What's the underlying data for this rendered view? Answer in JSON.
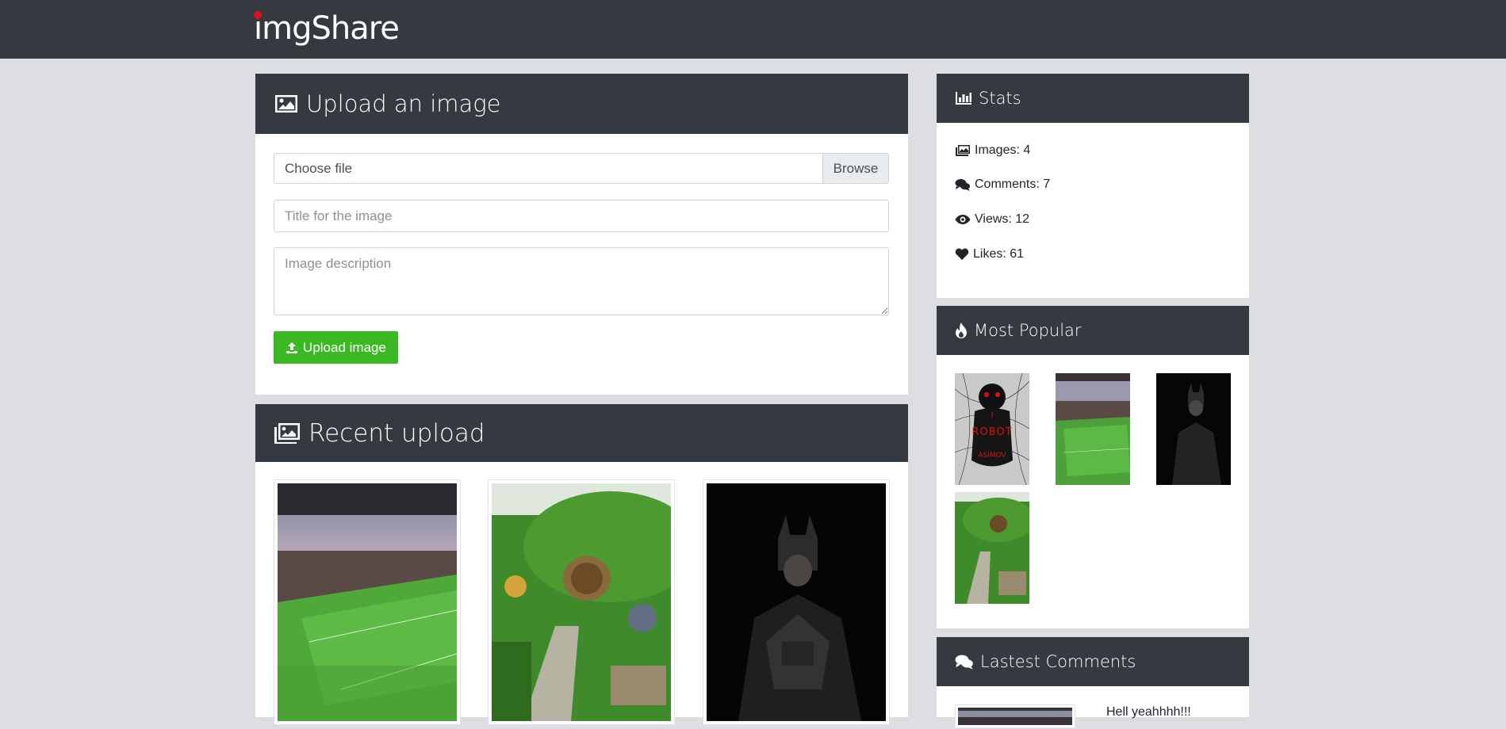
{
  "app": {
    "logo": "imgShare"
  },
  "upload": {
    "title": "Upload an image",
    "file_label": "Choose file",
    "browse_label": "Browse",
    "title_placeholder": "Title for the image",
    "description_placeholder": "Image description",
    "submit_label": "Upload image"
  },
  "recent": {
    "title": "Recent upload",
    "images": [
      {
        "subject": "football stadium"
      },
      {
        "subject": "hobbit hole"
      },
      {
        "subject": "batman"
      }
    ]
  },
  "stats": {
    "title": "Stats",
    "items": [
      {
        "icon": "images-icon",
        "text": "Images: 4"
      },
      {
        "icon": "comments-icon",
        "text": "Comments: 7"
      },
      {
        "icon": "eye-icon",
        "text": "Views: 12"
      },
      {
        "icon": "heart-icon",
        "text": "Likes: 61"
      }
    ]
  },
  "popular": {
    "title": "Most Popular",
    "images": [
      {
        "subject": "i robot book cover",
        "overlay": [
          "I",
          "ROBOT",
          "ASIMOV"
        ]
      },
      {
        "subject": "football stadium"
      },
      {
        "subject": "batman"
      },
      {
        "subject": "hobbit hole"
      }
    ]
  },
  "comments": {
    "title": "Lastest Comments",
    "items": [
      {
        "text": "Hell yeahhhh!!!"
      }
    ]
  },
  "colors": {
    "navbar": "#343a40",
    "page_bg": "#dcdee1",
    "upload_button": "#3bb924"
  }
}
